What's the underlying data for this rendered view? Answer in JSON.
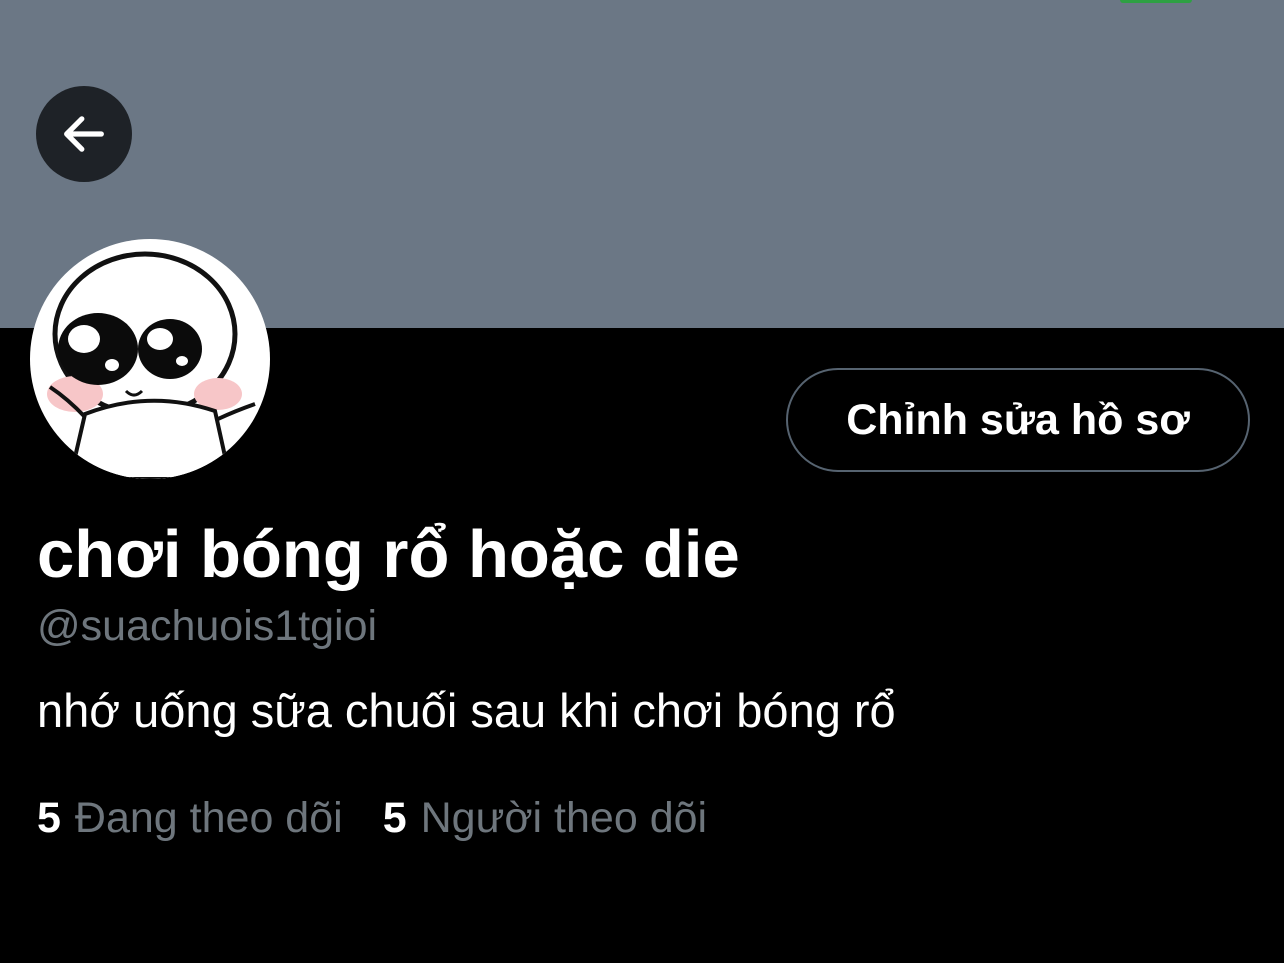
{
  "colors": {
    "banner": "#6b7785",
    "background": "#000000",
    "muted_text": "#6e767d",
    "status_green": "#2ea043"
  },
  "icons": {
    "back": "arrow-left-icon",
    "avatar": "cartoon-avatar"
  },
  "profile": {
    "edit_button_label": "Chỉnh sửa hồ sơ",
    "display_name": "chơi bóng rổ hoặc die",
    "handle": "@suachuois1tgioi",
    "bio": "nhớ uống sữa chuối sau khi chơi bóng rổ"
  },
  "stats": {
    "following_count": "5",
    "following_label": "Đang theo dõi",
    "followers_count": "5",
    "followers_label": "Người theo dõi"
  }
}
